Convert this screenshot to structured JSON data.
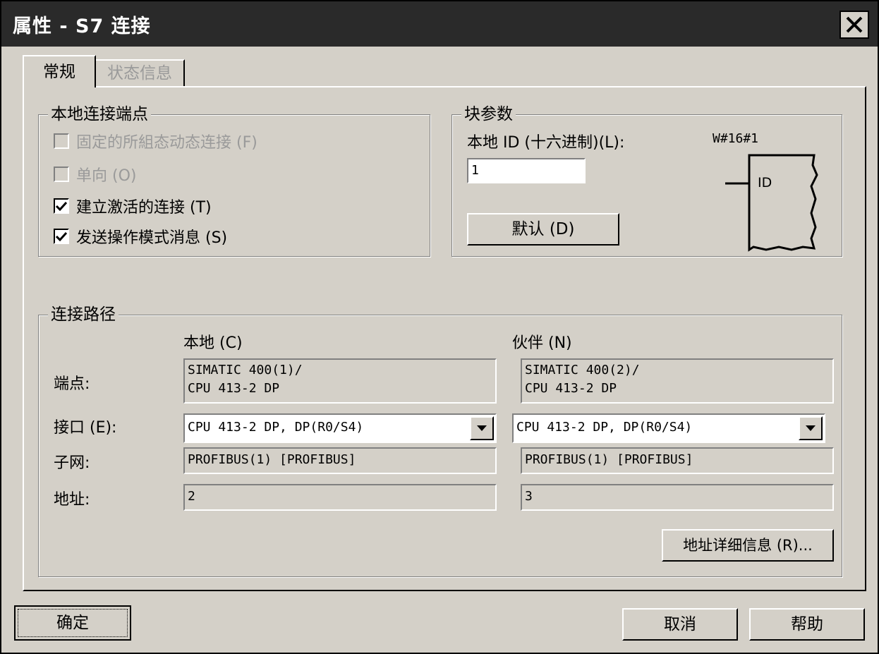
{
  "window": {
    "title": "属性 - S7 连接",
    "close_label": "X"
  },
  "tabs": [
    {
      "label": "常规",
      "active": true
    },
    {
      "label": "状态信息",
      "active": false
    }
  ],
  "local_endpoint": {
    "legend": "本地连接端点",
    "options": [
      {
        "label": "固定的所組态动态连接 (F)",
        "checked": false,
        "enabled": false
      },
      {
        "label": "单向 (O)",
        "checked": false,
        "enabled": false
      },
      {
        "label": "建立激活的连接 (T)",
        "checked": true,
        "enabled": true
      },
      {
        "label": "发送操作模式消息 (S)",
        "checked": true,
        "enabled": true
      }
    ]
  },
  "block_params": {
    "legend": "块参数",
    "local_id_label": "本地 ID (十六进制)(L):",
    "id_format": "W#16#1",
    "local_id_value": "1",
    "default_button": "默认 (D)",
    "diagram_label": "ID"
  },
  "connection_path": {
    "legend": "连接路径",
    "local_header": "本地 (C)",
    "partner_header": "伙伴 (N)",
    "rows": {
      "endpoint_label": "端点:",
      "interface_label": "接口 (E):",
      "subnet_label": "子网:",
      "address_label": "地址:"
    },
    "local": {
      "endpoint_line1": "SIMATIC 400(1)/",
      "endpoint_line2": "CPU 413-2 DP",
      "interface": "CPU 413-2 DP, DP(R0/S4)",
      "subnet": "PROFIBUS(1) [PROFIBUS]",
      "address": "2"
    },
    "partner": {
      "endpoint_line1": "SIMATIC 400(2)/",
      "endpoint_line2": "CPU 413-2 DP",
      "interface": "CPU 413-2 DP, DP(R0/S4)",
      "subnet": "PROFIBUS(1) [PROFIBUS]",
      "address": "3"
    },
    "address_details_button": "地址详细信息 (R)..."
  },
  "footer": {
    "ok": "确定",
    "cancel": "取消",
    "help": "帮助"
  }
}
